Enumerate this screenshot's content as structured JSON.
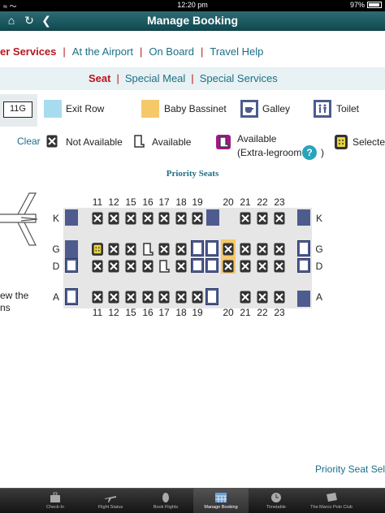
{
  "status_bar": {
    "time": "12:20 pm",
    "battery": "97%"
  },
  "nav": {
    "title": "Manage Booking"
  },
  "menu": {
    "items": [
      "er Services",
      "At the Airport",
      "On Board",
      "Travel Help"
    ],
    "separator": "|"
  },
  "submenu": {
    "items": [
      "Seat",
      "Special Meal",
      "Special Services"
    ],
    "separator": "|"
  },
  "legend": {
    "seat_code": "11G",
    "exit_row": "Exit Row",
    "baby_bassinet": "Baby Bassinet",
    "galley": "Galley",
    "toilet": "Toilet",
    "clear": "Clear",
    "not_available": "Not Available",
    "available": "Available",
    "available_extra_1": "Available",
    "available_extra_2": "(Extra-legroom",
    "available_extra_close": ")",
    "help": "?",
    "selected": "Selected"
  },
  "seatmap": {
    "title": "Priority Seats",
    "columns_left": [
      "11",
      "12",
      "15",
      "16",
      "17",
      "18",
      "19"
    ],
    "columns_right": [
      "20",
      "21",
      "22",
      "23"
    ],
    "rows": [
      "K",
      "G",
      "D",
      "A"
    ]
  },
  "left_text": {
    "line1": "ew the",
    "line2": "ns"
  },
  "bottom_link": "Priority Seat Sele",
  "tabs": [
    {
      "label": "Check-In",
      "icon": "luggage-icon"
    },
    {
      "label": "Flight Status",
      "icon": "plane-icon"
    },
    {
      "label": "Book Flights",
      "icon": "ticket-icon"
    },
    {
      "label": "Manage Booking",
      "icon": "calendar-icon"
    },
    {
      "label": "Timetable",
      "icon": "clock-icon"
    },
    {
      "label": "The Marco Polo Club",
      "icon": "card-icon"
    }
  ],
  "colors": {
    "accent": "#1b6f86",
    "active": "#b8161b",
    "navbar": "#1f5a63",
    "seat_block": "#4d5b8e",
    "bassinet": "#f5c869",
    "exit": "#a7dcef"
  }
}
